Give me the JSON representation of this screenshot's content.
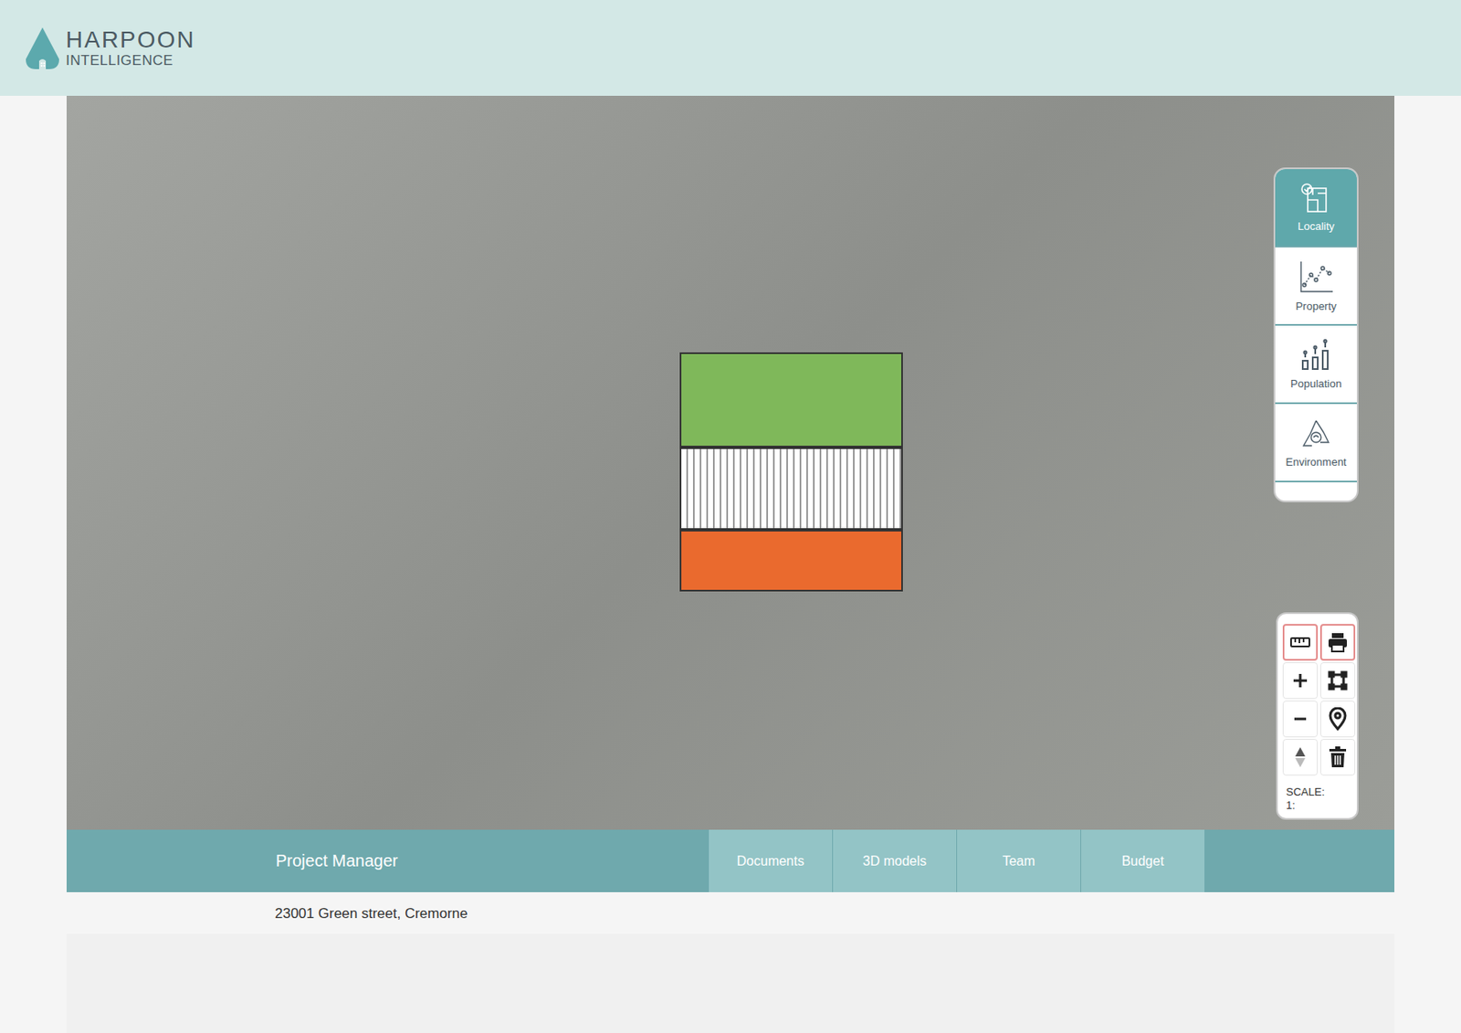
{
  "logo": {
    "line1": "HARPOON",
    "line2": "INTELLIGENCE"
  },
  "map": {
    "side_panel": [
      {
        "label": "Locality",
        "selected": true
      },
      {
        "label": "Property",
        "selected": false
      },
      {
        "label": "Population",
        "selected": false
      },
      {
        "label": "Environment",
        "selected": false
      }
    ],
    "tools": [
      {
        "active": true
      },
      {
        "active": true
      },
      {
        "active": false
      },
      {
        "active": false
      },
      {
        "active": false
      },
      {
        "active": false
      },
      {
        "active": false
      },
      {
        "active": false
      }
    ],
    "scale": {
      "label": "SCALE:",
      "value": "1:"
    }
  },
  "project_bar": {
    "title": "Project Manager",
    "tabs": [
      {
        "label": "Documents",
        "selected": false
      },
      {
        "label": "3D models",
        "selected": false
      },
      {
        "label": "Team",
        "selected": false
      },
      {
        "label": "Budget",
        "selected": false
      }
    ]
  },
  "address": "23001 Green street, Cremorne"
}
